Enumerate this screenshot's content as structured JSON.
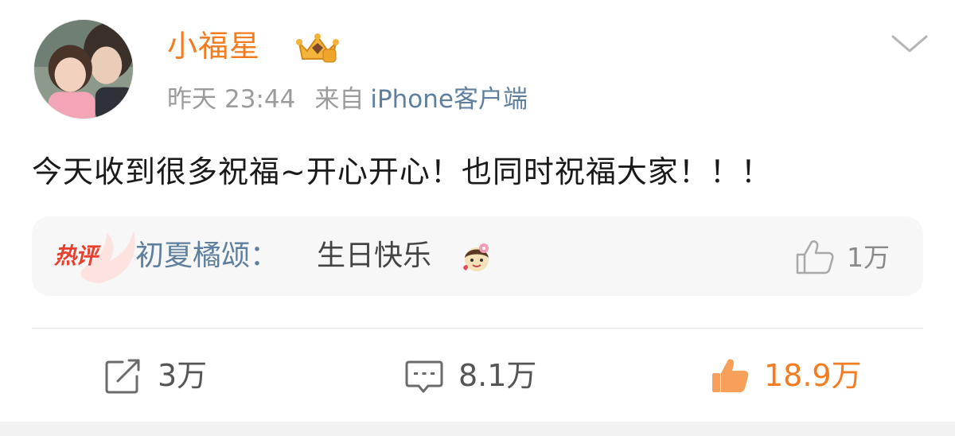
{
  "post": {
    "author": "小福星",
    "meta": {
      "time_label": "昨天",
      "time": "23:44",
      "from_label": "来自",
      "source": "iPhone客户端"
    },
    "text": "今天收到很多祝福~开心开心！也同时祝福大家！！！"
  },
  "icons": {
    "avatar": "avatar-photo",
    "vip_badge": "crown-vip-icon",
    "more": "chevron-down-icon",
    "comment_like": "thumbs-up-icon",
    "repost": "repost-icon",
    "comment": "comment-icon",
    "like": "thumbs-up-filled-icon",
    "emoji": "emoji-icon"
  },
  "hot_comment": {
    "badge_label": "热评",
    "author": "初夏橘颂：",
    "text": "生日快乐",
    "like_count": "1万"
  },
  "actions": {
    "repost_count": "3万",
    "comment_count": "8.1万",
    "like_count": "18.9万"
  },
  "colors": {
    "accent": "#f47b1f",
    "link": "#5f7f9f",
    "hot": "#e8402e",
    "muted": "#9b9b9b"
  }
}
